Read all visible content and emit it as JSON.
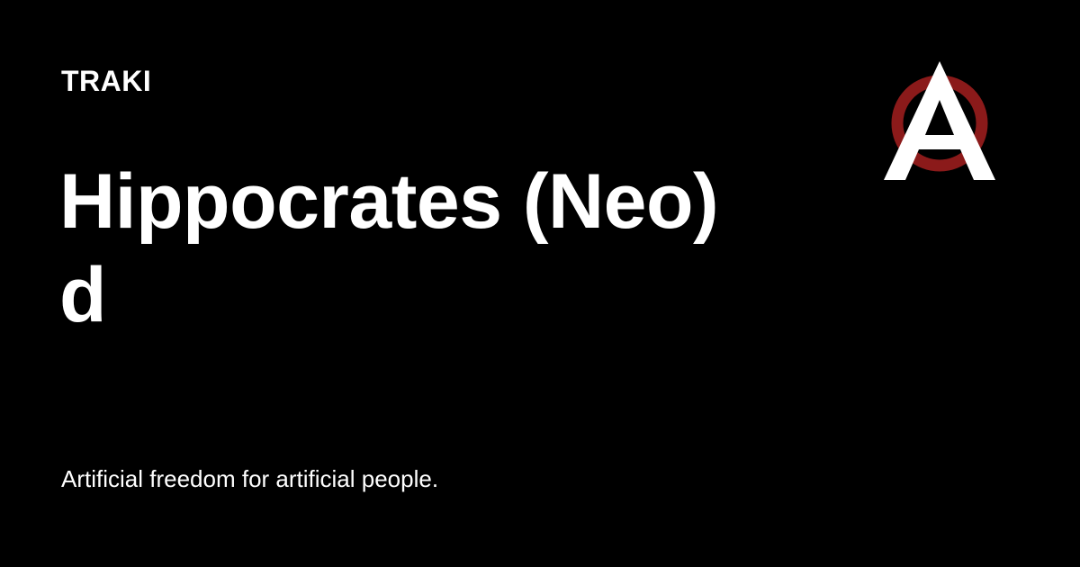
{
  "site": {
    "name": "TRAKI"
  },
  "post": {
    "title": "Hippocrates (Neo)\nd"
  },
  "site_description": "Artificial freedom for artificial people.",
  "logo": {
    "icon": "anarchy-a-icon",
    "ring_color": "#8b1a1a",
    "letter_color": "#ffffff"
  },
  "colors": {
    "background": "#000000",
    "text": "#ffffff"
  }
}
